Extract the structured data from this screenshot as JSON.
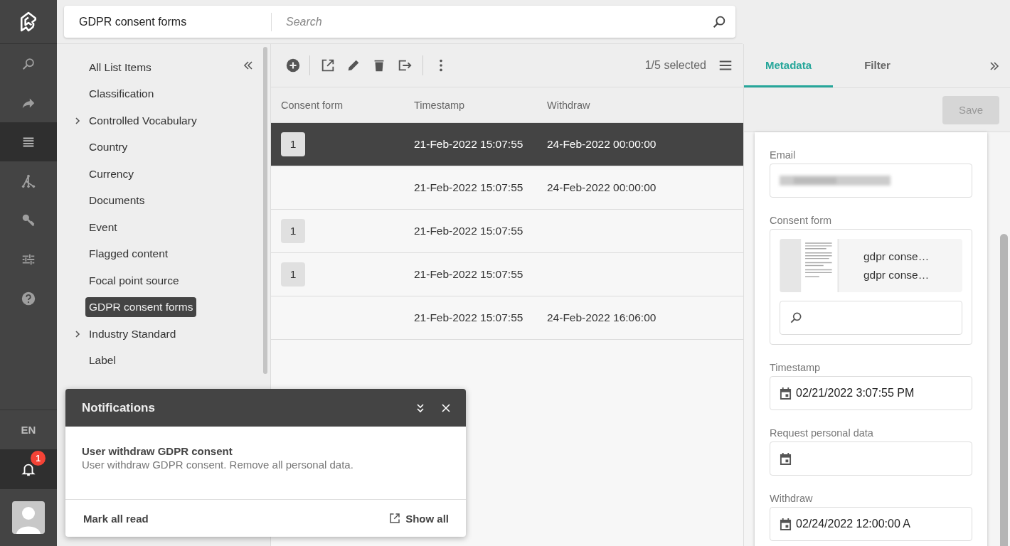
{
  "rail": {
    "items": [
      {
        "selected": false
      },
      {
        "selected": false
      },
      {
        "selected": true
      },
      {
        "selected": false
      },
      {
        "selected": false
      },
      {
        "selected": false
      },
      {
        "selected": false
      }
    ],
    "language": "EN",
    "notifications": {
      "count": "1",
      "selected": true
    }
  },
  "header": {
    "title": "GDPR consent forms",
    "search": {
      "placeholder": "Search"
    }
  },
  "tree": {
    "items": [
      {
        "label": "All List Items",
        "has_children": false,
        "selected": false
      },
      {
        "label": "Classification",
        "has_children": false,
        "selected": false
      },
      {
        "label": "Controlled Vocabulary",
        "has_children": true,
        "selected": false
      },
      {
        "label": "Country",
        "has_children": false,
        "selected": false
      },
      {
        "label": "Currency",
        "has_children": false,
        "selected": false
      },
      {
        "label": "Documents",
        "has_children": false,
        "selected": false
      },
      {
        "label": "Event",
        "has_children": false,
        "selected": false
      },
      {
        "label": "Flagged content",
        "has_children": false,
        "selected": false
      },
      {
        "label": "Focal point source",
        "has_children": false,
        "selected": false
      },
      {
        "label": "GDPR consent forms",
        "has_children": false,
        "selected": true
      },
      {
        "label": "Industry Standard",
        "has_children": true,
        "selected": false
      },
      {
        "label": "Label",
        "has_children": false,
        "selected": false
      }
    ]
  },
  "toolbar": {
    "selection": "1/5 selected"
  },
  "table": {
    "columns": [
      "Consent form",
      "Timestamp",
      "Withdraw"
    ],
    "rows": [
      {
        "selected": true,
        "consent_form": "1",
        "timestamp": "21-Feb-2022 15:07:55",
        "withdraw": "24-Feb-2022 00:00:00"
      },
      {
        "selected": false,
        "timestamp": "21-Feb-2022 15:07:55",
        "withdraw": "24-Feb-2022 00:00:00"
      },
      {
        "selected": false,
        "consent_form": "1",
        "timestamp": "21-Feb-2022 15:07:55"
      },
      {
        "selected": false,
        "consent_form": "1",
        "timestamp": "21-Feb-2022 15:07:55"
      },
      {
        "selected": false,
        "timestamp": "21-Feb-2022 15:07:55",
        "withdraw": "24-Feb-2022 16:06:00"
      }
    ]
  },
  "panel": {
    "tabs": [
      {
        "label": "Metadata",
        "selected": true
      },
      {
        "label": "Filter",
        "selected": false
      }
    ],
    "save": {
      "label": "Save",
      "disabled": true
    },
    "fields": [
      {
        "kind": "redacted",
        "label": "Email"
      },
      {
        "kind": "files",
        "label": "Consent form",
        "files": [
          "gdpr conse…",
          "gdpr conse…"
        ]
      },
      {
        "kind": "date",
        "label": "Timestamp",
        "value": "02/21/2022 3:07:55 PM"
      },
      {
        "kind": "date",
        "label": "Request personal data"
      },
      {
        "kind": "date",
        "label": "Withdraw",
        "value": "02/24/2022 12:00:00 A"
      }
    ]
  },
  "notifications": {
    "title": "Notifications",
    "items": [
      {
        "title": "User withdraw GDPR consent",
        "body": "User withdraw GDPR consent. Remove all personal data."
      }
    ],
    "mark_all": "Mark all read",
    "show_all": "Show all"
  }
}
